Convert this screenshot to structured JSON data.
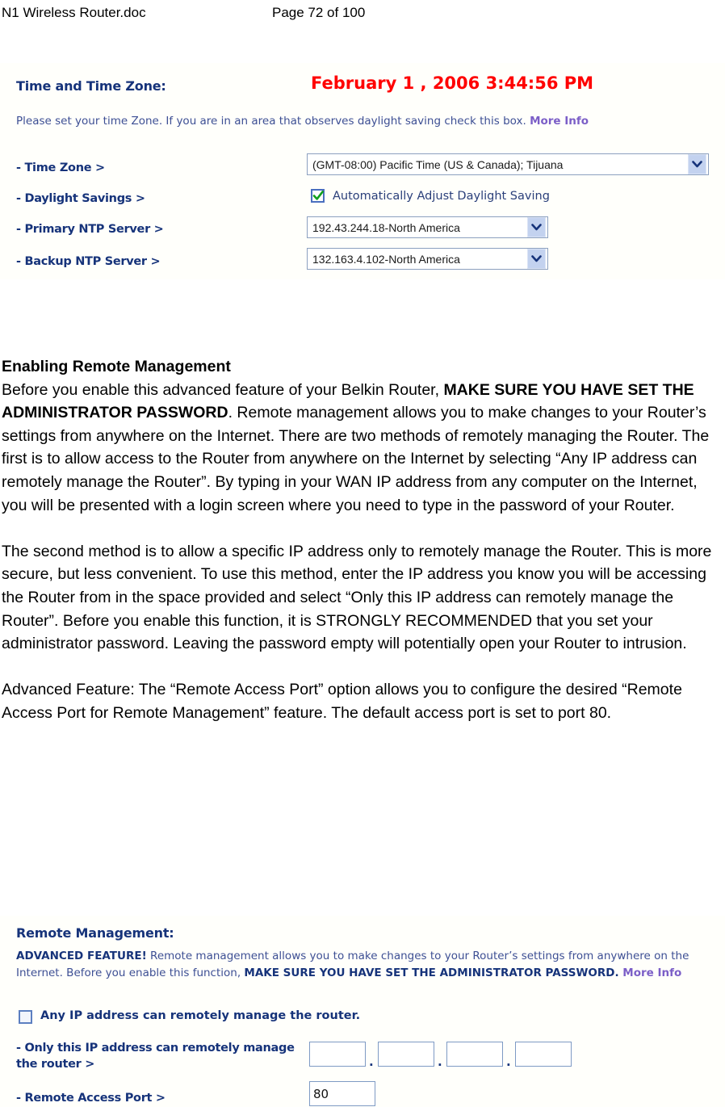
{
  "header": {
    "file_name": "N1 Wireless Router.doc",
    "page_label": "Page 72 of 100"
  },
  "time_panel": {
    "title": "Time and Time Zone:",
    "datetime": "February 1 , 2006    3:44:56 PM",
    "description_part1": "Please set your time Zone. If you are in an area that observes daylight saving check this box. ",
    "description_link": "More Info",
    "time_zone_label": "- Time Zone >",
    "time_zone_value": "(GMT-08:00) Pacific Time (US & Canada); Tijuana",
    "daylight_label": "- Daylight Savings >",
    "daylight_checkbox_label": "Automatically Adjust Daylight Saving",
    "daylight_checked": "true",
    "primary_ntp_label": "- Primary NTP Server >",
    "primary_ntp_value": "192.43.244.18-North America",
    "backup_ntp_label": "- Backup NTP Server >",
    "backup_ntp_value": "132.163.4.102-North America"
  },
  "article": {
    "heading": "Enabling Remote Management",
    "para1_a": "Before you enable this advanced feature of your Belkin Router, ",
    "para1_bold": "MAKE SURE YOU HAVE SET THE ADMINISTRATOR PASSWORD",
    "para1_b": ". Remote management allows you to make changes to your Router’s settings from anywhere on the Internet. There are two methods of remotely managing the Router. The first is to allow access to the Router from anywhere on the Internet by selecting “Any IP address can remotely manage the Router”. By typing in your WAN IP address from any computer on the Internet, you will be presented with a login screen where you need to type in the password of your Router.",
    "para2": "The second method is to allow a specific IP address only to remotely manage the Router. This is more secure, but less convenient. To use this method, enter the IP address you know you will be accessing the Router from in the space provided and select “Only this IP address can remotely manage the Router”. Before you enable this function, it is STRONGLY RECOMMENDED that you set your administrator password. Leaving the password empty will potentially open your Router to intrusion.",
    "para3": "Advanced Feature: The “Remote Access Port” option allows you to configure the desired “Remote Access Port for Remote Management” feature. The default access port is set to port 80."
  },
  "remote_panel": {
    "title": "Remote Management:",
    "desc_bold1": "ADVANCED FEATURE!",
    "desc_text1": " Remote management allows you to make changes to your Router’s settings from anywhere on the Internet. Before you enable this function, ",
    "desc_bold2": "MAKE SURE YOU HAVE SET THE ADMINISTRATOR PASSWORD.",
    "desc_link": " More Info",
    "any_ip_label": "Any IP address can remotely manage the router.",
    "any_ip_checked": "false",
    "only_ip_label": "- Only this IP address can remotely manage the router >",
    "ip_octet_1": "",
    "ip_octet_2": "",
    "ip_octet_3": "",
    "ip_octet_4": "",
    "octet_separator": ".",
    "remote_port_label": "- Remote Access Port >",
    "remote_port_value": "80"
  },
  "colors": {
    "navy": "#16337a",
    "red": "#ff0000",
    "link_purple": "#7b5ec7",
    "field_border": "#7e9ac4"
  }
}
